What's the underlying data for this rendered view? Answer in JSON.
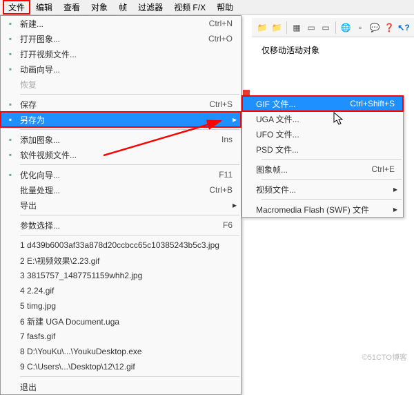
{
  "menubar": [
    "文件",
    "编辑",
    "查看",
    "对象",
    "帧",
    "过滤器",
    "视频 F/X",
    "帮助"
  ],
  "panel_text": "仅移动活动对象",
  "toolbar_icons": [
    "folder-icon",
    "folder-icon",
    "grid-icon",
    "doc-icon",
    "doc-icon",
    "globe-icon",
    "page-icon",
    "chat-icon",
    "help-icon"
  ],
  "file_menu": [
    {
      "t": "item",
      "icon": "new-icon",
      "label": "新建...",
      "sc": "Ctrl+N"
    },
    {
      "t": "item",
      "icon": "open-icon",
      "label": "打开图象...",
      "sc": "Ctrl+O"
    },
    {
      "t": "item",
      "icon": "video-icon",
      "label": "打开视频文件...",
      "sc": ""
    },
    {
      "t": "item",
      "icon": "anim-icon",
      "label": "动画向导...",
      "sc": ""
    },
    {
      "t": "item",
      "icon": "",
      "label": "恢复",
      "sc": "",
      "disabled": true
    },
    {
      "t": "sep"
    },
    {
      "t": "item",
      "icon": "save-icon",
      "label": "保存",
      "sc": "Ctrl+S"
    },
    {
      "t": "item",
      "icon": "saveas-icon",
      "label": "另存为",
      "sc": "",
      "arrow": true,
      "sel": true,
      "box": true
    },
    {
      "t": "sep"
    },
    {
      "t": "item",
      "icon": "addimg-icon",
      "label": "添加图象...",
      "sc": "Ins"
    },
    {
      "t": "item",
      "icon": "addvid-icon",
      "label": "软件视频文件...",
      "sc": ""
    },
    {
      "t": "sep"
    },
    {
      "t": "item",
      "icon": "opt-icon",
      "label": "优化向导...",
      "sc": "F11"
    },
    {
      "t": "item",
      "icon": "",
      "label": "批量处理...",
      "sc": "Ctrl+B"
    },
    {
      "t": "item",
      "icon": "",
      "label": "导出",
      "sc": "",
      "arrow": true
    },
    {
      "t": "sep"
    },
    {
      "t": "item",
      "icon": "",
      "label": "参数选择...",
      "sc": "F6"
    },
    {
      "t": "sep"
    },
    {
      "t": "item",
      "icon": "",
      "label": "1 d439b6003af33a878d20ccbcc65c10385243b5c3.jpg",
      "sc": ""
    },
    {
      "t": "item",
      "icon": "",
      "label": "2 E:\\视频效果\\2.23.gif",
      "sc": ""
    },
    {
      "t": "item",
      "icon": "",
      "label": "3 3815757_1487751159whh2.jpg",
      "sc": ""
    },
    {
      "t": "item",
      "icon": "",
      "label": "4 2.24.gif",
      "sc": ""
    },
    {
      "t": "item",
      "icon": "",
      "label": "5 timg.jpg",
      "sc": ""
    },
    {
      "t": "item",
      "icon": "",
      "label": "6 新建 UGA Document.uga",
      "sc": ""
    },
    {
      "t": "item",
      "icon": "",
      "label": "7 fasfs.gif",
      "sc": ""
    },
    {
      "t": "item",
      "icon": "",
      "label": "8 D:\\YouKu\\...\\YoukuDesktop.exe",
      "sc": ""
    },
    {
      "t": "item",
      "icon": "",
      "label": "9 C:\\Users\\...\\Desktop\\12\\12.gif",
      "sc": ""
    },
    {
      "t": "sep"
    },
    {
      "t": "item",
      "icon": "",
      "label": "退出",
      "sc": ""
    }
  ],
  "saveas_submenu": [
    {
      "t": "item",
      "label": "GIF 文件...",
      "sc": "Ctrl+Shift+S",
      "sel": true,
      "box": true
    },
    {
      "t": "item",
      "label": "UGA 文件...",
      "sc": ""
    },
    {
      "t": "item",
      "label": "UFO 文件...",
      "sc": ""
    },
    {
      "t": "item",
      "label": "PSD 文件...",
      "sc": ""
    },
    {
      "t": "sep"
    },
    {
      "t": "item",
      "label": "图象帧...",
      "sc": "Ctrl+E"
    },
    {
      "t": "sep"
    },
    {
      "t": "item",
      "label": "视频文件...",
      "sc": "",
      "arrow": true
    },
    {
      "t": "sep"
    },
    {
      "t": "item",
      "label": "Macromedia Flash (SWF) 文件",
      "sc": "",
      "arrow": true
    }
  ],
  "watermark": "©51CTO博客"
}
